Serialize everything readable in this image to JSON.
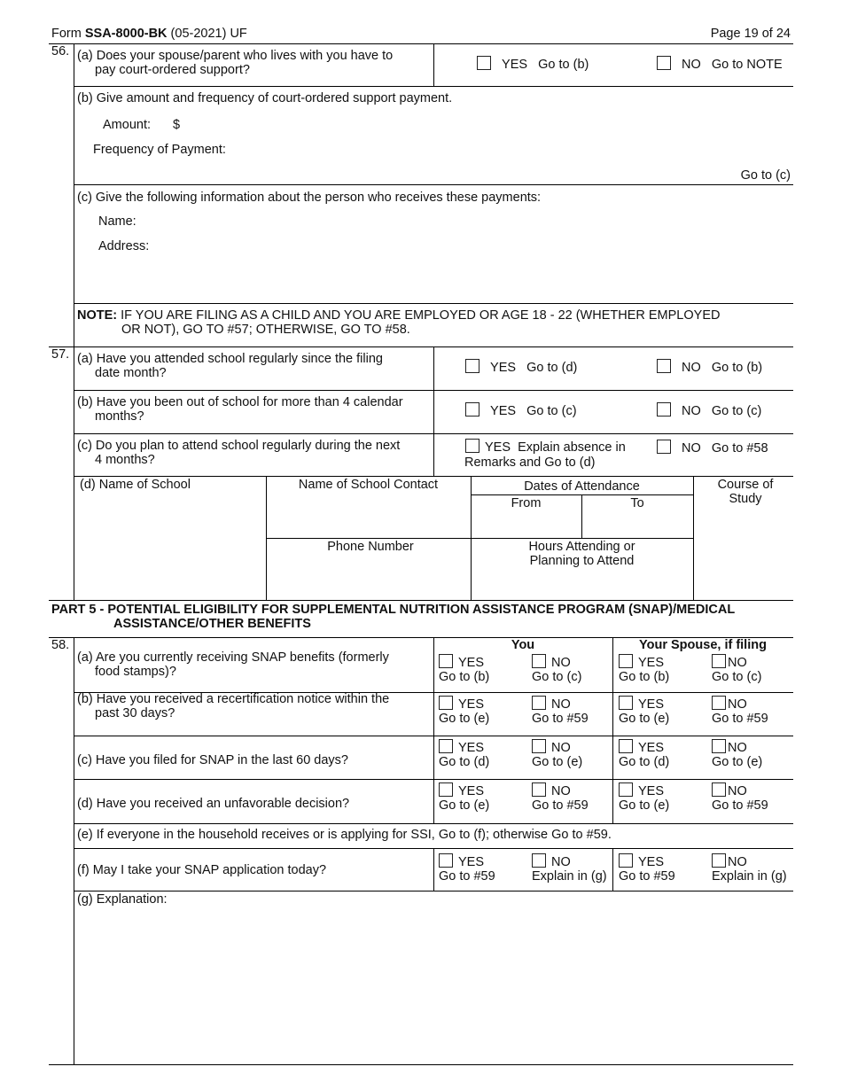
{
  "header": {
    "form_prefix": "Form ",
    "form_id": "SSA-8000-BK",
    "form_suffix": " (05-2021) UF",
    "page": "Page 19 of 24"
  },
  "q56": {
    "number": "56.",
    "a": {
      "line1": "(a) Does your spouse/parent who lives with you have to",
      "line2": "pay court-ordered support?",
      "yes": "YES   Go to (b)",
      "no": "NO   Go to NOTE"
    },
    "b": {
      "text": "(b) Give amount and frequency of court-ordered support payment.",
      "amount_label": "Amount:",
      "amount_symbol": "$",
      "frequency_label": "Frequency of Payment:",
      "goto": "Go to (c)"
    },
    "c": {
      "text": "(c) Give the following information about the person who receives these payments:",
      "name_label": "Name:",
      "address_label": "Address:"
    },
    "note": {
      "label": "NOTE:",
      "line1": " IF YOU ARE FILING AS A CHILD AND YOU ARE EMPLOYED OR AGE 18 - 22 (WHETHER EMPLOYED",
      "line2": "OR NOT), GO TO #57; OTHERWISE, GO TO #58."
    }
  },
  "q57": {
    "number": "57.",
    "a": {
      "line1": "(a) Have you attended school regularly since the filing",
      "line2": "date month?",
      "yes": "YES   Go to (d)",
      "no": "NO   Go to (b)"
    },
    "b": {
      "line1": "(b) Have you been out of school for more than 4 calendar",
      "line2": "months?",
      "yes": "YES   Go to (c)",
      "no": "NO   Go to (c)"
    },
    "c": {
      "line1": "(c) Do you plan to attend school regularly during the next",
      "line2": "4 months?",
      "yes_line1": "YES  Explain absence in",
      "yes_line2": "Remarks and Go to (d)",
      "no": "NO   Go to #58"
    },
    "d": {
      "school_name": "(d) Name of School",
      "contact": "Name of School Contact",
      "dates": "Dates of Attendance",
      "from": "From",
      "to": "To",
      "course_line1": "Course of",
      "course_line2": "Study",
      "phone": "Phone Number",
      "hours_line1": "Hours Attending or",
      "hours_line2": "Planning to Attend"
    }
  },
  "part5": {
    "line1": "PART 5 - POTENTIAL ELIGIBILITY FOR SUPPLEMENTAL NUTRITION ASSISTANCE PROGRAM (SNAP)/MEDICAL",
    "line2": "ASSISTANCE/OTHER BENEFITS"
  },
  "q58": {
    "number": "58.",
    "col_you": "You",
    "col_spouse": "Your Spouse, if filing",
    "rows": [
      {
        "line1": "(a) Are you currently receiving SNAP benefits (formerly",
        "line2": "food stamps)?",
        "opts": [
          {
            "label": "YES",
            "goto": "Go to (b)"
          },
          {
            "label": "NO",
            "goto": "Go to (c)"
          },
          {
            "label": "YES",
            "goto": "Go to (b)"
          },
          {
            "label": "NO",
            "goto": "Go to (c)"
          }
        ]
      },
      {
        "line1": "(b) Have you received a recertification notice within the",
        "line2": "past 30 days?",
        "opts": [
          {
            "label": "YES",
            "goto": "Go to (e)"
          },
          {
            "label": "NO",
            "goto": "Go to #59"
          },
          {
            "label": "YES",
            "goto": "Go to (e)"
          },
          {
            "label": "NO",
            "goto": "Go to #59"
          }
        ]
      },
      {
        "line1": "(c) Have you filed for SNAP in the last 60 days?",
        "line2": "",
        "opts": [
          {
            "label": "YES",
            "goto": "Go to (d)"
          },
          {
            "label": "NO",
            "goto": "Go to (e)"
          },
          {
            "label": "YES",
            "goto": "Go to (d)"
          },
          {
            "label": "NO",
            "goto": "Go to (e)"
          }
        ]
      },
      {
        "line1": "(d) Have you received an unfavorable decision?",
        "line2": "",
        "opts": [
          {
            "label": "YES",
            "goto": "Go to (e)"
          },
          {
            "label": "NO",
            "goto": "Go to #59"
          },
          {
            "label": "YES",
            "goto": "Go to (e)"
          },
          {
            "label": "NO",
            "goto": "Go to #59"
          }
        ]
      }
    ],
    "e": "(e) If everyone in the household receives or is applying for SSI, Go to (f); otherwise Go to #59.",
    "f": {
      "text": "(f) May I take your SNAP application today?",
      "opts": [
        {
          "label": "YES",
          "goto": "Go to #59"
        },
        {
          "label": "NO",
          "goto": "Explain in (g)"
        },
        {
          "label": "YES",
          "goto": "Go to #59"
        },
        {
          "label": "NO",
          "goto": "Explain in (g)"
        }
      ]
    },
    "g": "(g) Explanation:"
  }
}
